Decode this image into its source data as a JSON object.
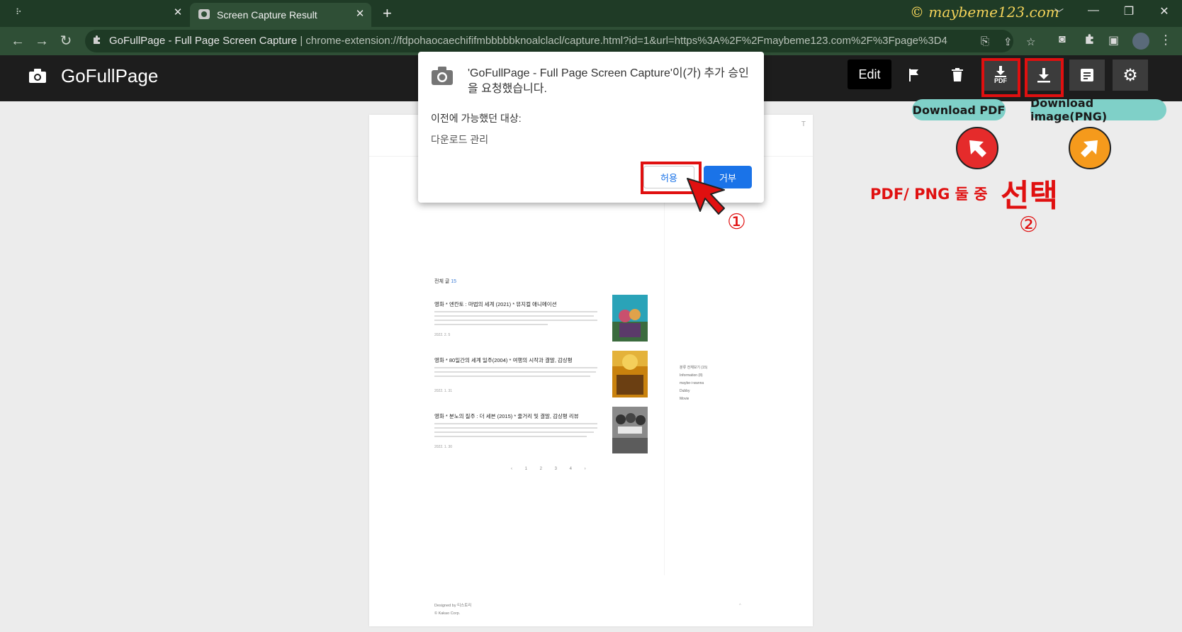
{
  "browser": {
    "tabs": [
      {
        "label": ""
      },
      {
        "label": "Screen Capture Result"
      }
    ],
    "watermark": "© maybeme123.com",
    "address_bar": {
      "site_name": "GoFullPage - Full Page Screen Capture",
      "url": "chrome-extension://fdpohaocaechififmbbbbbknoalclacl/capture.html?id=1&url=https%3A%2F%2Fmaybeme123.com%2F%3Fpage%3D4"
    }
  },
  "app": {
    "name": "GoFullPage",
    "toolbar": {
      "edit_label": "Edit",
      "pdf_icon_label": "PDF"
    }
  },
  "dialog": {
    "message": "'GoFullPage - Full Page Screen Capture'이(가) 추가 승인을 요청했습니다.",
    "subheading": "이전에 가능했던 대상:",
    "permission": "다운로드 관리",
    "allow_label": "허용",
    "deny_label": "거부"
  },
  "annotations": {
    "download_pdf": "Download PDF",
    "download_png": "Download image(PNG)",
    "choose_text": "PDF/ PNG 둘 중",
    "choose_big": "선택",
    "step1": "①",
    "step2": "②"
  },
  "capture_preview": {
    "corner_mark": "T",
    "count_label": "전체 글",
    "count_value": "15",
    "posts": [
      {
        "title": "영화 * 엔칸토 : 마법의 세계 (2021) * 뮤지컬 애니메이션",
        "date": "2022. 2. 5"
      },
      {
        "title": "영화 * 80일간의 세계 일주(2004) * 여행의 시작과 결말, 감상평",
        "date": "2022. 1. 31"
      },
      {
        "title": "영화 * 분노의 질주 : 더 세븐 (2015) * 줄거리 및 결말, 감상평 리뷰",
        "date": "2022. 1. 30"
      }
    ],
    "pager": "‹ 1 2 3 4 ›",
    "sidebar": [
      "분류 전체보기 (15)",
      "Information (8)",
      "maybe-i-wanna",
      "Dubby",
      "Movie"
    ],
    "footer_1": "Designed by 티스토리",
    "footer_2": "© Kakao Corp."
  },
  "colors": {
    "annotation_red": "#e01010",
    "callout_teal": "#7fd0c8",
    "dialog_blue": "#1a73e8",
    "orange_circle": "#f59a1c"
  }
}
